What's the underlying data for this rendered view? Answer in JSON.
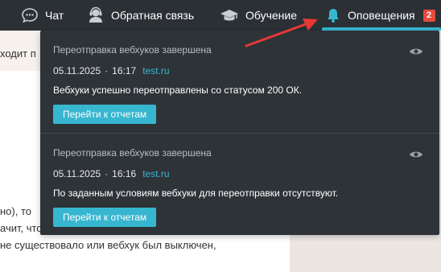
{
  "nav": {
    "chat_label": "Чат",
    "feedback_label": "Обратная связь",
    "learning_label": "Обучение",
    "alerts_label": "Оповещения",
    "alerts_count": "2"
  },
  "background": {
    "fragment_1": "ходит п",
    "fragment_2": "но), то",
    "fragment_3": "ачит, что",
    "fragment_4": "не существовало или вебхук был выключен,"
  },
  "notifications": [
    {
      "title": "Переотправка вебхуков завершена",
      "date": "05.11.2025",
      "time": "16:17",
      "site": "test.ru",
      "message": "Вебхуки успешно переотправлены со статусом 200 ОК.",
      "button": "Перейти к отчетам"
    },
    {
      "title": "Переотправка вебхуков завершена",
      "date": "05.11.2025",
      "time": "16:16",
      "site": "test.ru",
      "message": "По заданным условиям вебхуки для переотправки отсутствуют.",
      "button": "Перейти к отчетам"
    }
  ],
  "colors": {
    "nav_bg": "#2b3035",
    "panel_bg": "#2e3338",
    "accent": "#37b6d0",
    "badge": "#e84a3c",
    "arrow": "#e53935"
  }
}
